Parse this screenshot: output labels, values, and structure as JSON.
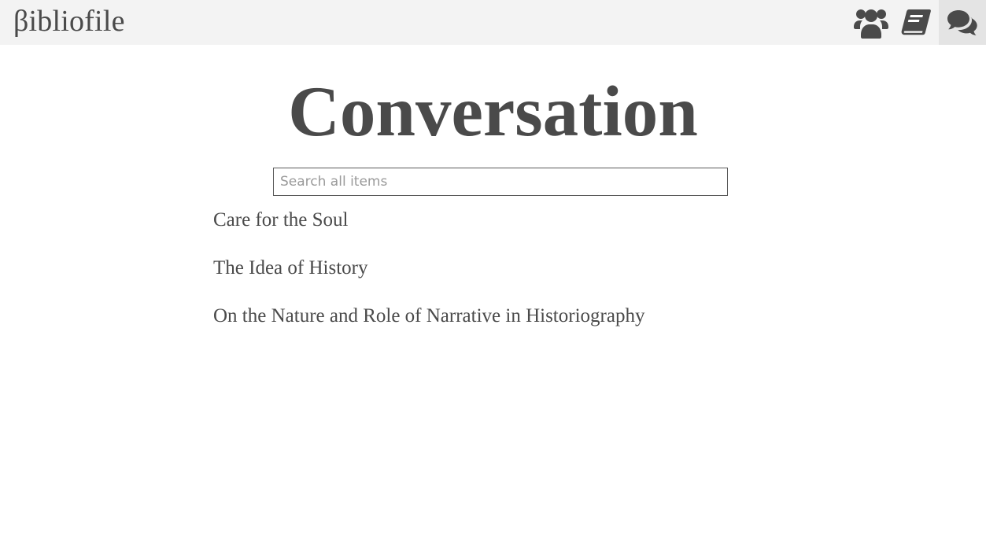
{
  "brand": {
    "name": "βibliofile"
  },
  "nav": {
    "icons": [
      {
        "name": "users-icon",
        "active": false
      },
      {
        "name": "book-icon",
        "active": false
      },
      {
        "name": "comments-icon",
        "active": true
      }
    ]
  },
  "page": {
    "title": "Conversation",
    "search": {
      "placeholder": "Search all items",
      "value": ""
    }
  },
  "items": [
    {
      "title": "Care for the Soul"
    },
    {
      "title": "The Idea of History"
    },
    {
      "title": "On the Nature and Role of Narrative in Historiography"
    }
  ],
  "colors": {
    "text": "#4a4a4a",
    "topbar": "#f3f3f3",
    "active_nav": "#e4e4e4",
    "background": "#ffffff"
  }
}
